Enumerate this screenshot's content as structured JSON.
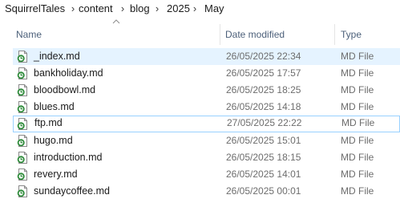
{
  "breadcrumb": [
    "SquirrelTales",
    "content",
    "blog",
    "2025",
    "May"
  ],
  "columns": {
    "name": "Name",
    "date_modified": "Date modified",
    "type": "Type"
  },
  "sort": {
    "column": "name",
    "direction": "ascending"
  },
  "files": [
    {
      "name": "_index.md",
      "date": "26/05/2025 22:34",
      "type": "MD File",
      "icon": "md-file-icon",
      "selected": true
    },
    {
      "name": "bankholiday.md",
      "date": "26/05/2025 17:57",
      "type": "MD File",
      "icon": "md-file-icon"
    },
    {
      "name": "bloodbowl.md",
      "date": "26/05/2025 18:25",
      "type": "MD File",
      "icon": "md-file-icon"
    },
    {
      "name": "blues.md",
      "date": "26/05/2025 14:18",
      "type": "MD File",
      "icon": "md-file-icon"
    },
    {
      "name": "ftp.md",
      "date": "27/05/2025 22:22",
      "type": "MD File",
      "icon": "md-file-icon",
      "focused": true
    },
    {
      "name": "hugo.md",
      "date": "26/05/2025 15:01",
      "type": "MD File",
      "icon": "md-file-icon"
    },
    {
      "name": "introduction.md",
      "date": "26/05/2025 18:15",
      "type": "MD File",
      "icon": "md-file-icon"
    },
    {
      "name": "revery.md",
      "date": "26/05/2025 14:01",
      "type": "MD File",
      "icon": "md-file-icon"
    },
    {
      "name": "sundaycoffee.md",
      "date": "26/05/2025 00:01",
      "type": "MD File",
      "icon": "md-file-icon"
    }
  ],
  "colors": {
    "selected_row": "#e5f3ff",
    "focus_border": "#99d1ff",
    "header_text": "#4c607a",
    "icon_green": "#2e8b3a"
  }
}
